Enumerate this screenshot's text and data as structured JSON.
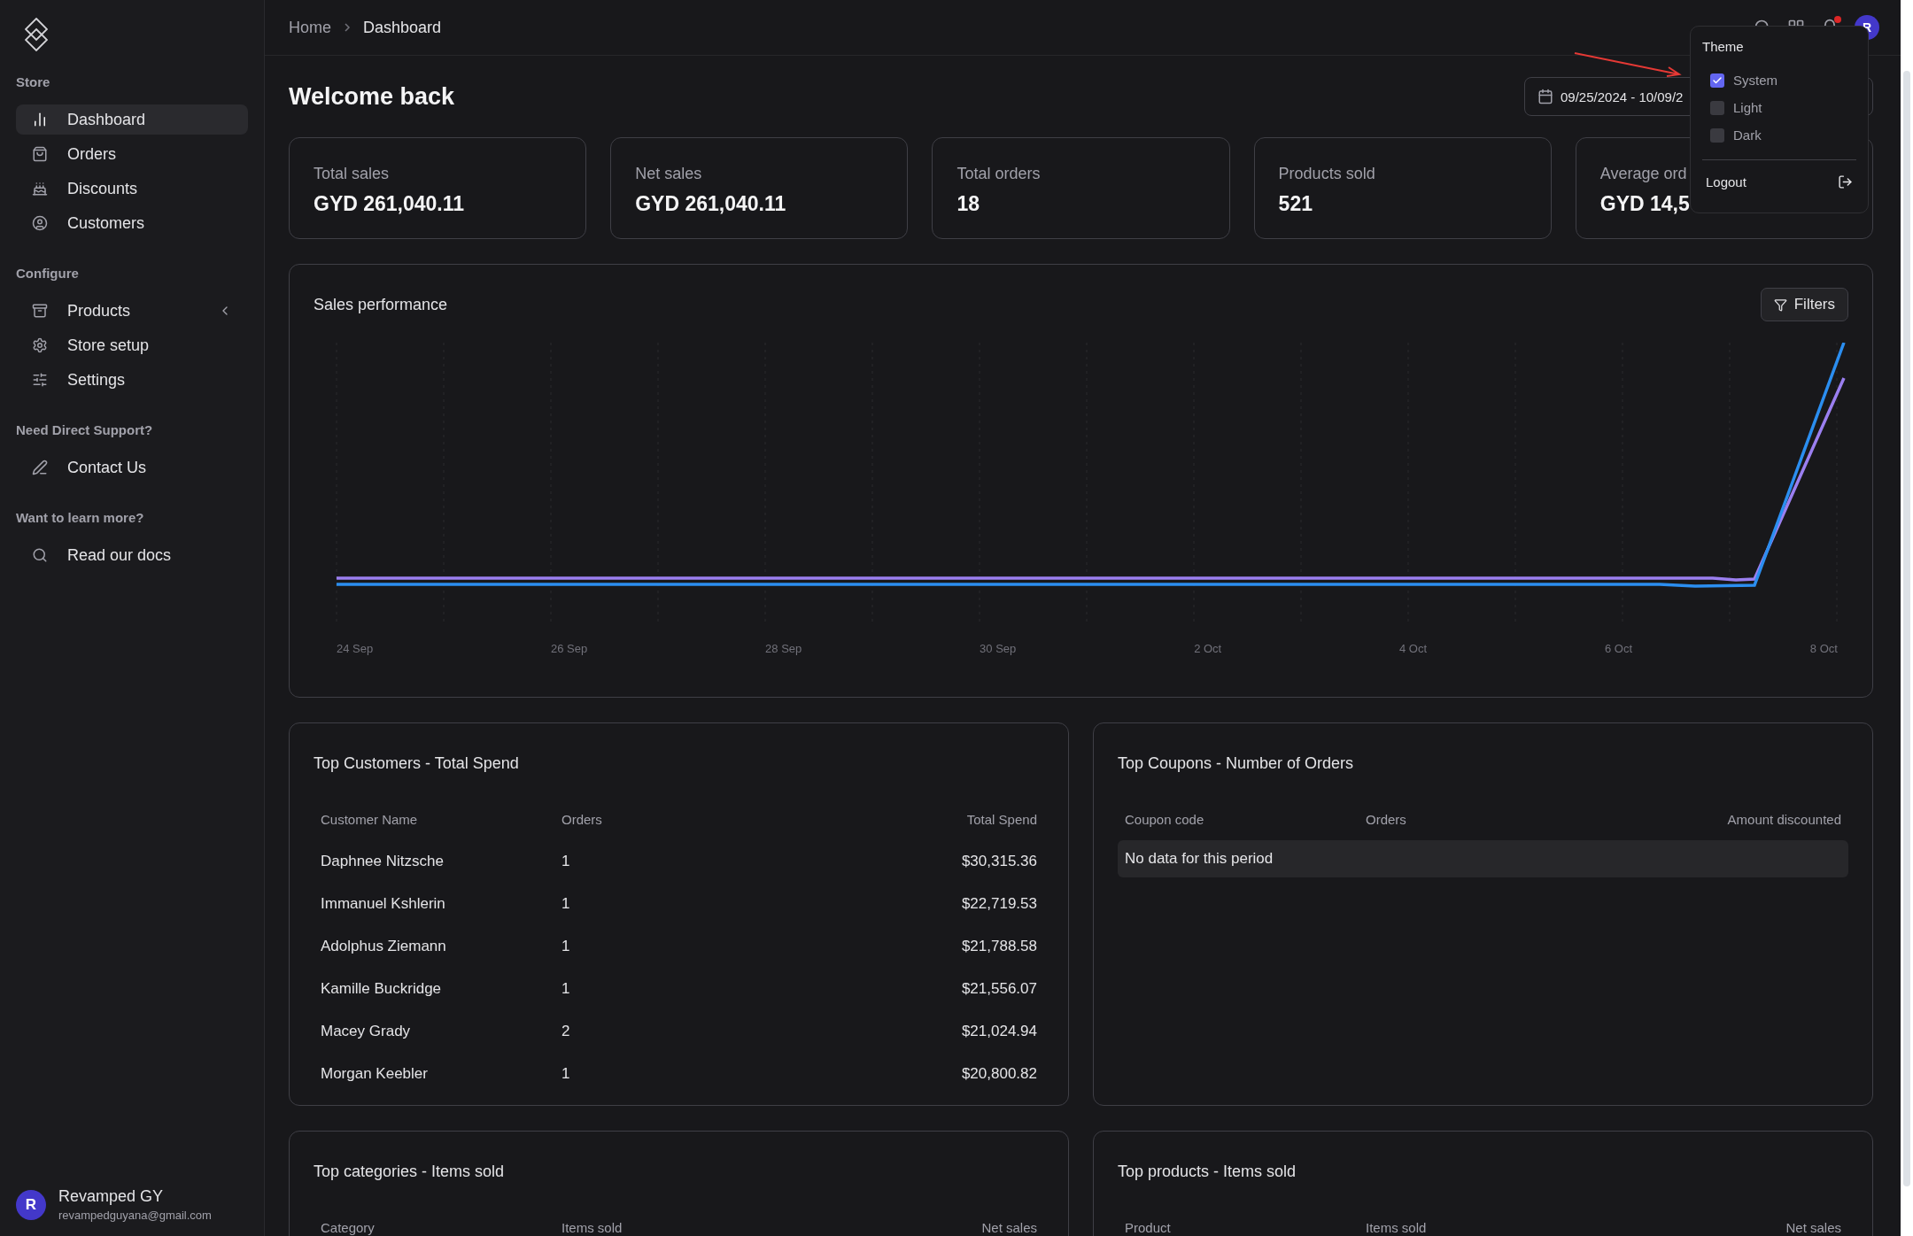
{
  "sidebar": {
    "sections": [
      {
        "title": "Store",
        "items": [
          {
            "label": "Dashboard",
            "selected": true
          },
          {
            "label": "Orders",
            "selected": false
          },
          {
            "label": "Discounts",
            "selected": false
          },
          {
            "label": "Customers",
            "selected": false
          }
        ]
      },
      {
        "title": "Configure",
        "items": [
          {
            "label": "Products",
            "selected": false
          },
          {
            "label": "Store setup",
            "selected": false
          },
          {
            "label": "Settings",
            "selected": false
          }
        ]
      },
      {
        "title": "Need Direct Support?",
        "items": [
          {
            "label": "Contact Us",
            "selected": false
          }
        ]
      },
      {
        "title": "Want to learn more?",
        "items": [
          {
            "label": "Read our docs",
            "selected": false
          }
        ]
      }
    ],
    "user": {
      "initial": "R",
      "name": "Revamped GY",
      "email": "revampedguyana@gmail.com"
    }
  },
  "header": {
    "breadcrumb": [
      "Home",
      "Dashboard"
    ],
    "has_notification": true,
    "avatar": "R"
  },
  "theme_menu": {
    "title": "Theme",
    "options": [
      {
        "label": "System",
        "checked": true
      },
      {
        "label": "Light",
        "checked": false
      },
      {
        "label": "Dark",
        "checked": false
      }
    ],
    "logout": "Logout"
  },
  "page": {
    "title": "Welcome back",
    "date_range": "09/25/2024 - 10/09/2"
  },
  "stats": [
    {
      "label": "Total sales",
      "value": "GYD 261,040.11"
    },
    {
      "label": "Net sales",
      "value": "GYD 261,040.11"
    },
    {
      "label": "Total orders",
      "value": "18"
    },
    {
      "label": "Products sold",
      "value": "521"
    },
    {
      "label": "Average ord",
      "value": "GYD 14,5"
    }
  ],
  "sales_chart": {
    "title": "Sales performance",
    "filters": "Filters",
    "x_labels": [
      "24 Sep",
      "26 Sep",
      "28 Sep",
      "30 Sep",
      "2 Oct",
      "4 Oct",
      "6 Oct",
      "8 Oct"
    ]
  },
  "top_customers": {
    "title": "Top Customers - Total Spend",
    "columns": [
      "Customer Name",
      "Orders",
      "Total Spend"
    ],
    "rows": [
      [
        "Daphnee Nitzsche",
        "1",
        "$30,315.36"
      ],
      [
        "Immanuel Kshlerin",
        "1",
        "$22,719.53"
      ],
      [
        "Adolphus Ziemann",
        "1",
        "$21,788.58"
      ],
      [
        "Kamille Buckridge",
        "1",
        "$21,556.07"
      ],
      [
        "Macey Grady",
        "2",
        "$21,024.94"
      ],
      [
        "Morgan Keebler",
        "1",
        "$20,800.82"
      ]
    ]
  },
  "top_coupons": {
    "title": "Top Coupons - Number of Orders",
    "columns": [
      "Coupon code",
      "Orders",
      "Amount discounted"
    ],
    "empty_message": "No data for this period"
  },
  "top_categories": {
    "title": "Top categories - Items sold",
    "columns": [
      "Category",
      "Items sold",
      "Net sales"
    ]
  },
  "top_products": {
    "title": "Top products - Items sold",
    "columns": [
      "Product",
      "Items sold",
      "Net sales"
    ]
  }
}
